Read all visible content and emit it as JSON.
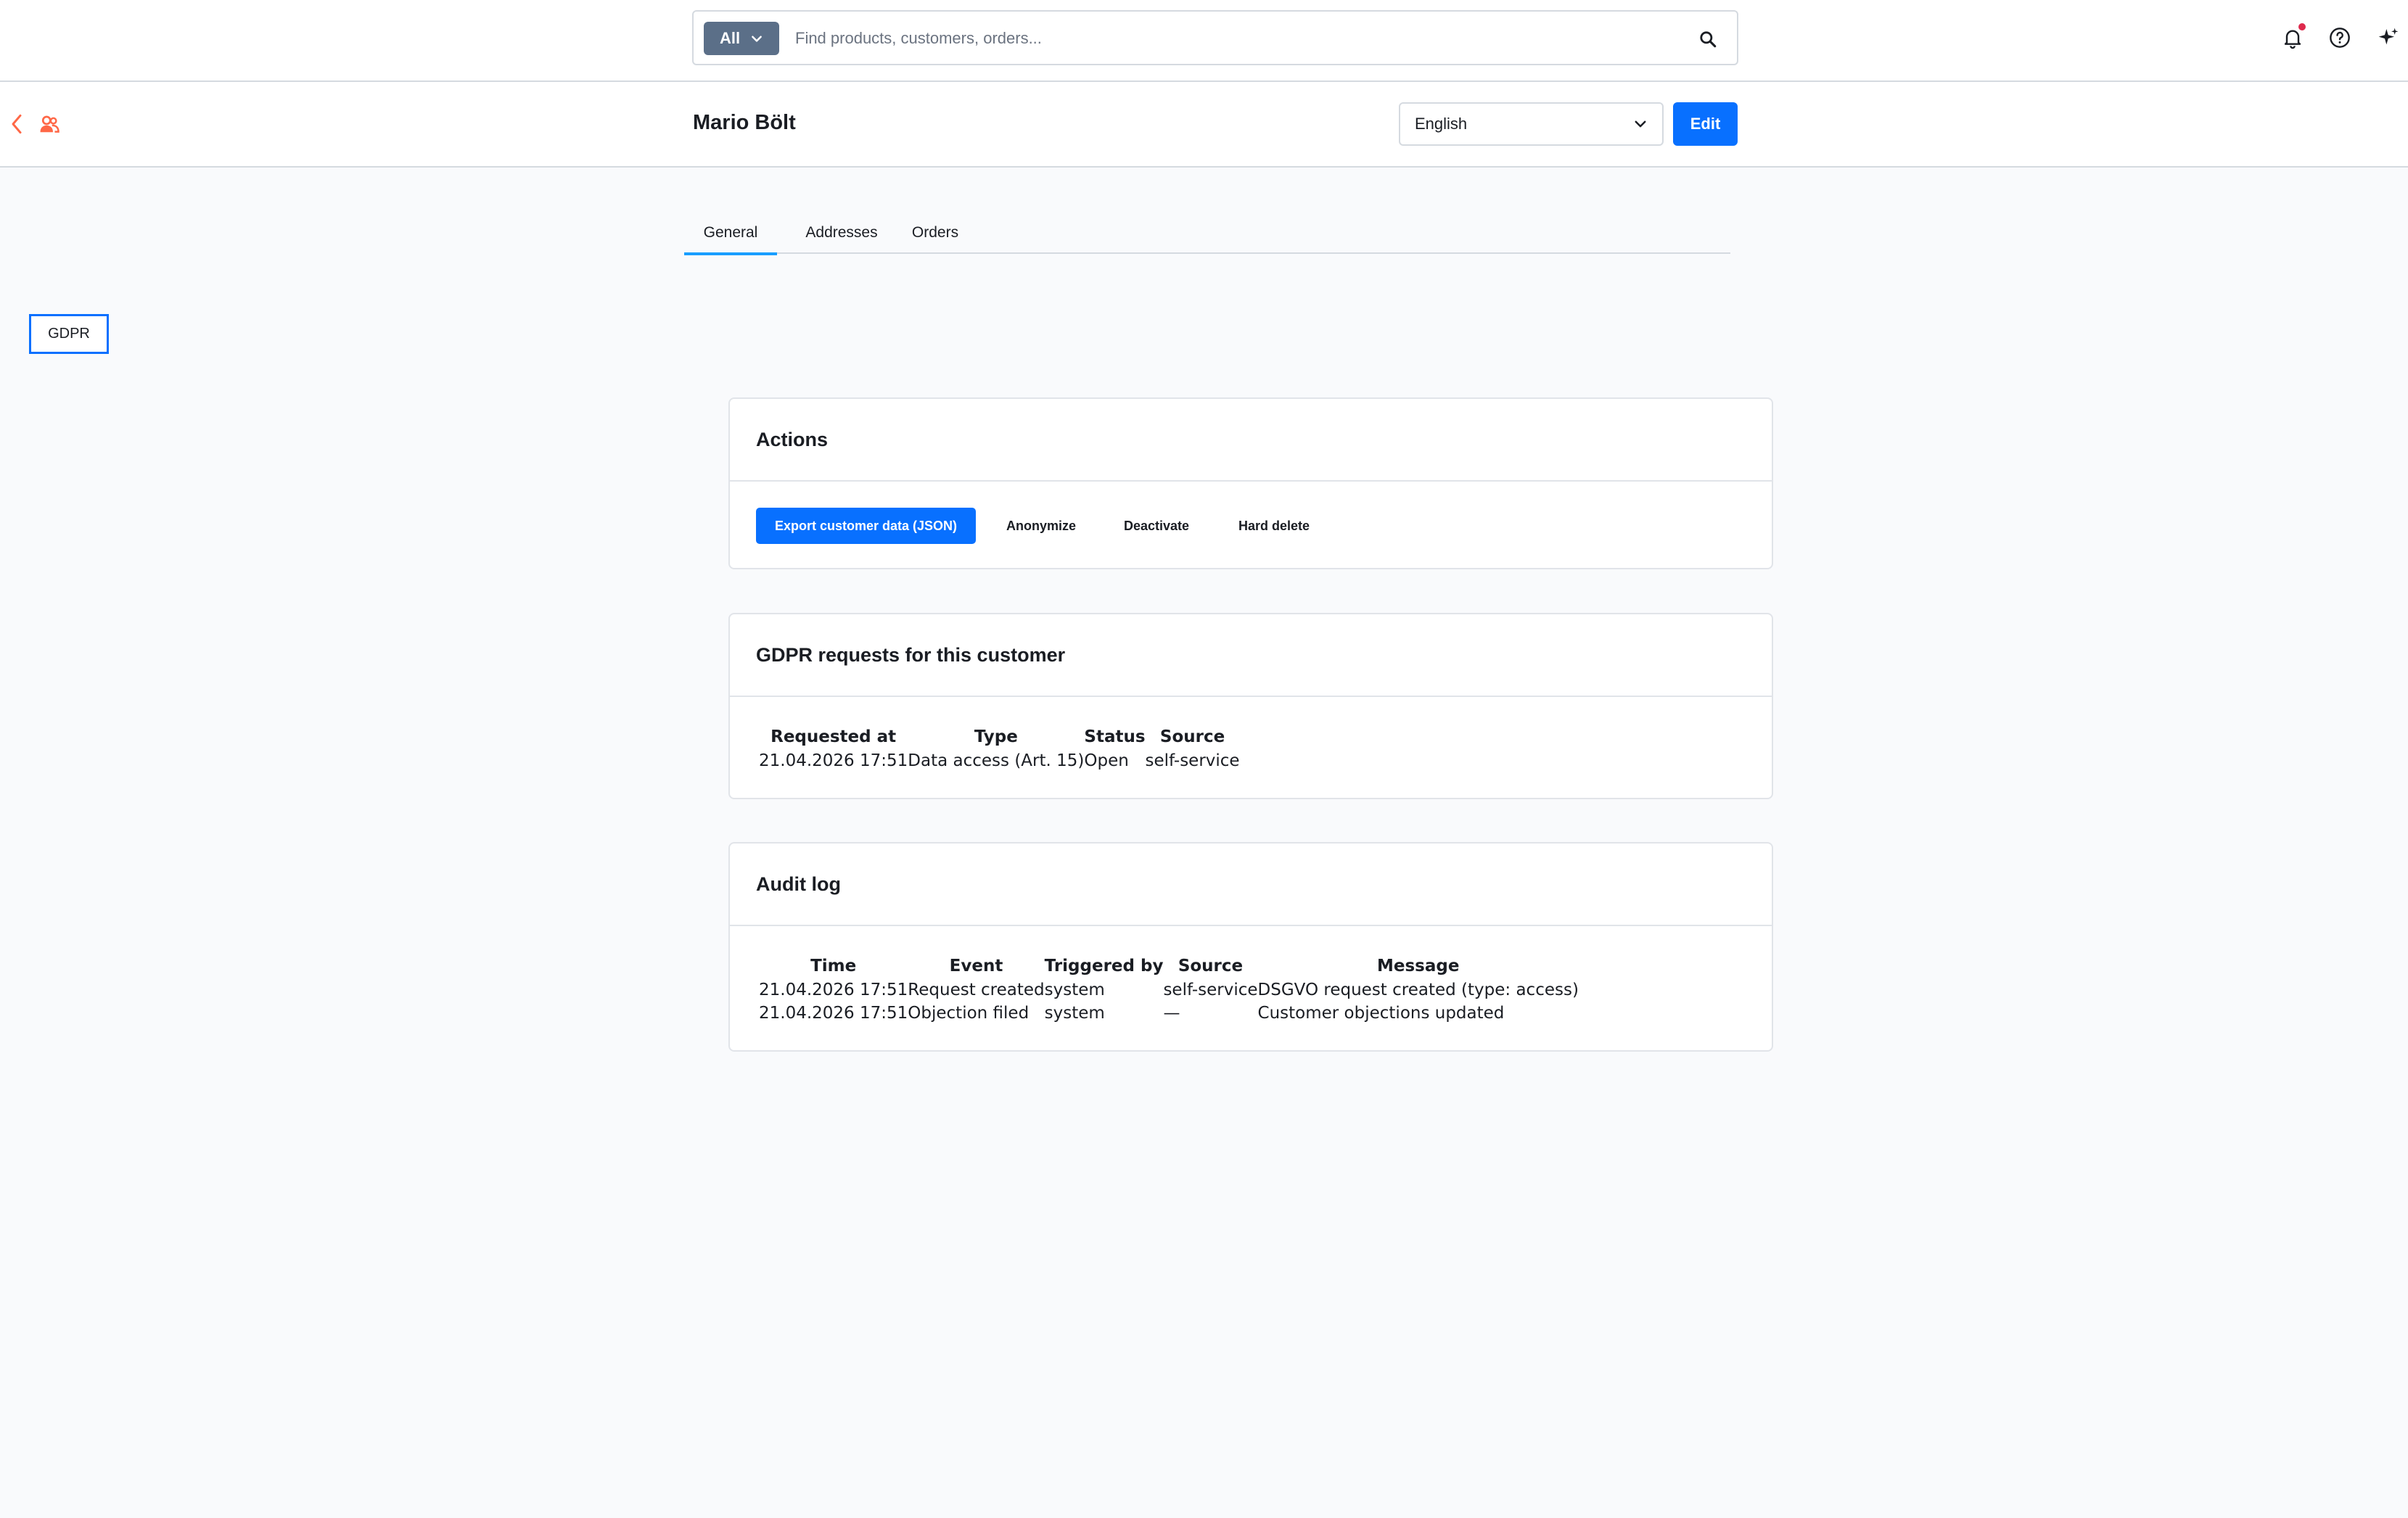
{
  "search": {
    "type_label": "All",
    "placeholder": "Find products, customers, orders..."
  },
  "header": {
    "title": "Mario Bölt",
    "language": "English",
    "edit_label": "Edit"
  },
  "tabs": [
    {
      "label": "General",
      "active": true
    },
    {
      "label": "Addresses",
      "active": false
    },
    {
      "label": "Orders",
      "active": false
    }
  ],
  "gdpr_button": "GDPR",
  "actions_card": {
    "title": "Actions",
    "export_label": "Export customer data (JSON)",
    "anonymize_label": "Anonymize",
    "deactivate_label": "Deactivate",
    "hard_delete_label": "Hard delete"
  },
  "requests_card": {
    "title": "GDPR requests for this customer",
    "columns": [
      "Requested at",
      "Type",
      "Status",
      "Source"
    ],
    "rows": [
      [
        "21.04.2026 17:51",
        "Data access (Art. 15)",
        "Open",
        "self-service"
      ]
    ]
  },
  "audit_card": {
    "title": "Audit log",
    "columns": [
      "Time",
      "Event",
      "Triggered by",
      "Source",
      "Message"
    ],
    "rows": [
      [
        "21.04.2026 17:51",
        "Request created",
        "system",
        "self-service",
        "DSGVO request created (type: access)"
      ],
      [
        "21.04.2026 17:51",
        "Objection filed",
        "system",
        "—",
        "Customer objections updated"
      ]
    ]
  },
  "colors": {
    "primary": "#0870ff",
    "tab_active": "#189eff",
    "module_accent": "#ff6847",
    "search_type_bg": "#5b6f88",
    "notification_dot": "#de294c"
  },
  "icons": [
    "search-icon",
    "bell-icon",
    "help-icon",
    "sparkle-icon",
    "chevron-left-icon",
    "customers-icon",
    "chevron-down-icon"
  ]
}
